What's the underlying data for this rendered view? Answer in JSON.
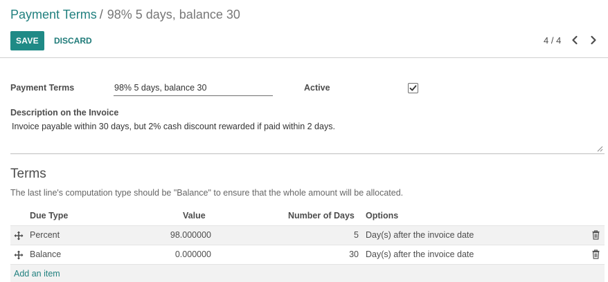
{
  "breadcrumb": {
    "parent": "Payment Terms",
    "separator": "/",
    "current": "98% 5 days, balance 30"
  },
  "toolbar": {
    "save_label": "SAVE",
    "discard_label": "DISCARD"
  },
  "pager": {
    "value": "4 / 4"
  },
  "form": {
    "payment_terms_label": "Payment Terms",
    "payment_terms_value": "98% 5 days, balance 30",
    "active_label": "Active",
    "active_checked": true,
    "description_label": "Description on the Invoice",
    "description_value": "Invoice payable within 30 days, but 2% cash discount rewarded if paid within 2 days."
  },
  "terms": {
    "title": "Terms",
    "help": "The last line's computation type should be \"Balance\" to ensure that the whole amount will be allocated.",
    "columns": [
      "Due Type",
      "Value",
      "Number of Days",
      "Options"
    ],
    "rows": [
      {
        "due_type": "Percent",
        "value": "98.000000",
        "days": "5",
        "options": "Day(s) after the invoice date"
      },
      {
        "due_type": "Balance",
        "value": "0.000000",
        "days": "30",
        "options": "Day(s) after the invoice date"
      }
    ],
    "add_item": "Add an item"
  },
  "icons": {
    "pager_prev": "chevron-left-icon",
    "pager_next": "chevron-right-icon",
    "row_handle": "move-handle-icon",
    "row_delete": "trash-icon",
    "checkbox": "checkmark-icon"
  },
  "colors": {
    "primary": "#1f8a86",
    "link": "#21807f"
  }
}
